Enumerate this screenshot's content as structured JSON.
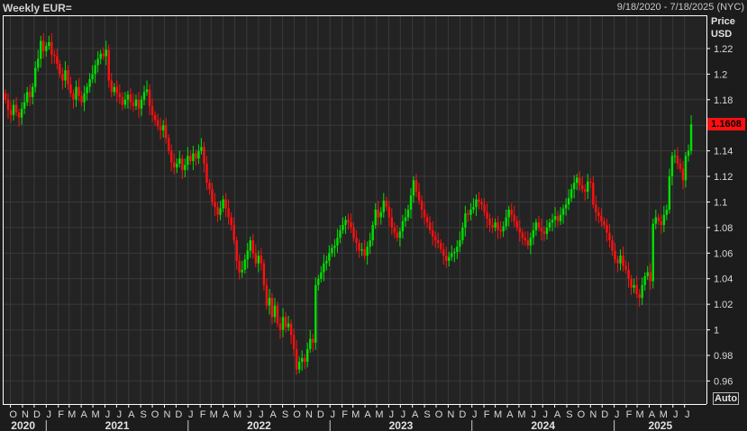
{
  "header": {
    "title": "Weekly EUR=",
    "date_range": "9/18/2020 - 7/18/2025 (NYC)"
  },
  "axis": {
    "unit_line1": "Price",
    "unit_line2": "USD",
    "auto_button": "Auto",
    "last_price_label": "1.1608"
  },
  "colors": {
    "up": "#00e000",
    "down": "#ff1010",
    "background": "#232323",
    "grid": "#3a3a3a",
    "last_price_bg": "#ff1010"
  },
  "chart_data": {
    "type": "candlestick",
    "title": "Weekly EUR=",
    "frequency": "weekly",
    "start_date": "2020-09-18",
    "end_date": "2025-07-18",
    "ylabel": "Price USD",
    "ylim": [
      0.942,
      1.246
    ],
    "grid": true,
    "y_ticks": [
      "0.96",
      "0.98",
      "1",
      "1.02",
      "1.04",
      "1.06",
      "1.08",
      "1.1",
      "1.12",
      "1.14",
      "1.16",
      "1.18",
      "1.2",
      "1.22"
    ],
    "x_month_labels": [
      "O",
      "N",
      "D",
      "J",
      "F",
      "M",
      "A",
      "M",
      "J",
      "J",
      "A",
      "S",
      "O",
      "N",
      "D",
      "J",
      "F",
      "M",
      "A",
      "M",
      "J",
      "J",
      "A",
      "S",
      "O",
      "N",
      "D",
      "J",
      "F",
      "M",
      "A",
      "M",
      "J",
      "J",
      "A",
      "S",
      "O",
      "N",
      "D",
      "J",
      "F",
      "M",
      "A",
      "M",
      "J",
      "J",
      "A",
      "S",
      "O",
      "N",
      "D",
      "J",
      "F",
      "M",
      "A",
      "M",
      "J",
      "J"
    ],
    "x_year_labels": [
      "2020",
      "2021",
      "2022",
      "2023",
      "2024",
      "2025"
    ],
    "last_close": 1.1608,
    "close": [
      1.18,
      1.172,
      1.168,
      1.176,
      1.17,
      1.166,
      1.173,
      1.178,
      1.186,
      1.182,
      1.19,
      1.205,
      1.212,
      1.226,
      1.218,
      1.222,
      1.225,
      1.215,
      1.214,
      1.208,
      1.2,
      1.195,
      1.203,
      1.192,
      1.185,
      1.18,
      1.19,
      1.183,
      1.178,
      1.185,
      1.19,
      1.196,
      1.2,
      1.207,
      1.212,
      1.216,
      1.214,
      1.219,
      1.195,
      1.186,
      1.19,
      1.185,
      1.182,
      1.176,
      1.18,
      1.184,
      1.178,
      1.175,
      1.18,
      1.173,
      1.18,
      1.186,
      1.188,
      1.175,
      1.168,
      1.164,
      1.159,
      1.156,
      1.16,
      1.15,
      1.14,
      1.131,
      1.127,
      1.13,
      1.134,
      1.125,
      1.129,
      1.136,
      1.132,
      1.138,
      1.134,
      1.14,
      1.143,
      1.13,
      1.115,
      1.11,
      1.1,
      1.096,
      1.09,
      1.095,
      1.102,
      1.095,
      1.088,
      1.082,
      1.07,
      1.054,
      1.045,
      1.047,
      1.055,
      1.062,
      1.07,
      1.06,
      1.052,
      1.058,
      1.052,
      1.035,
      1.019,
      1.025,
      1.01,
      1.019,
      1.005,
      1.0,
      1.01,
      1.002,
      1.005,
      0.996,
      0.985,
      0.969,
      0.975,
      0.978,
      0.975,
      0.985,
      0.993,
      0.99,
      1.035,
      1.04,
      1.045,
      1.052,
      1.054,
      1.06,
      1.064,
      1.066,
      1.072,
      1.078,
      1.082,
      1.086,
      1.084,
      1.08,
      1.072,
      1.068,
      1.062,
      1.063,
      1.058,
      1.065,
      1.07,
      1.082,
      1.094,
      1.088,
      1.092,
      1.101,
      1.096,
      1.088,
      1.08,
      1.076,
      1.072,
      1.077,
      1.085,
      1.088,
      1.094,
      1.105,
      1.117,
      1.108,
      1.101,
      1.094,
      1.088,
      1.084,
      1.078,
      1.073,
      1.07,
      1.068,
      1.063,
      1.058,
      1.054,
      1.057,
      1.06,
      1.061,
      1.065,
      1.07,
      1.08,
      1.091,
      1.09,
      1.094,
      1.096,
      1.102,
      1.1,
      1.098,
      1.092,
      1.087,
      1.082,
      1.08,
      1.084,
      1.078,
      1.077,
      1.081,
      1.088,
      1.094,
      1.09,
      1.085,
      1.08,
      1.076,
      1.072,
      1.07,
      1.066,
      1.072,
      1.078,
      1.084,
      1.08,
      1.077,
      1.075,
      1.08,
      1.084,
      1.086,
      1.089,
      1.085,
      1.09,
      1.095,
      1.098,
      1.103,
      1.11,
      1.115,
      1.119,
      1.113,
      1.11,
      1.108,
      1.116,
      1.115,
      1.098,
      1.092,
      1.089,
      1.085,
      1.082,
      1.076,
      1.07,
      1.062,
      1.055,
      1.052,
      1.058,
      1.05,
      1.047,
      1.04,
      1.033,
      1.035,
      1.028,
      1.025,
      1.035,
      1.042,
      1.045,
      1.038,
      1.083,
      1.088,
      1.085,
      1.082,
      1.09,
      1.094,
      1.12,
      1.136,
      1.136,
      1.13,
      1.126,
      1.117,
      1.136,
      1.14,
      1.1608
    ]
  }
}
